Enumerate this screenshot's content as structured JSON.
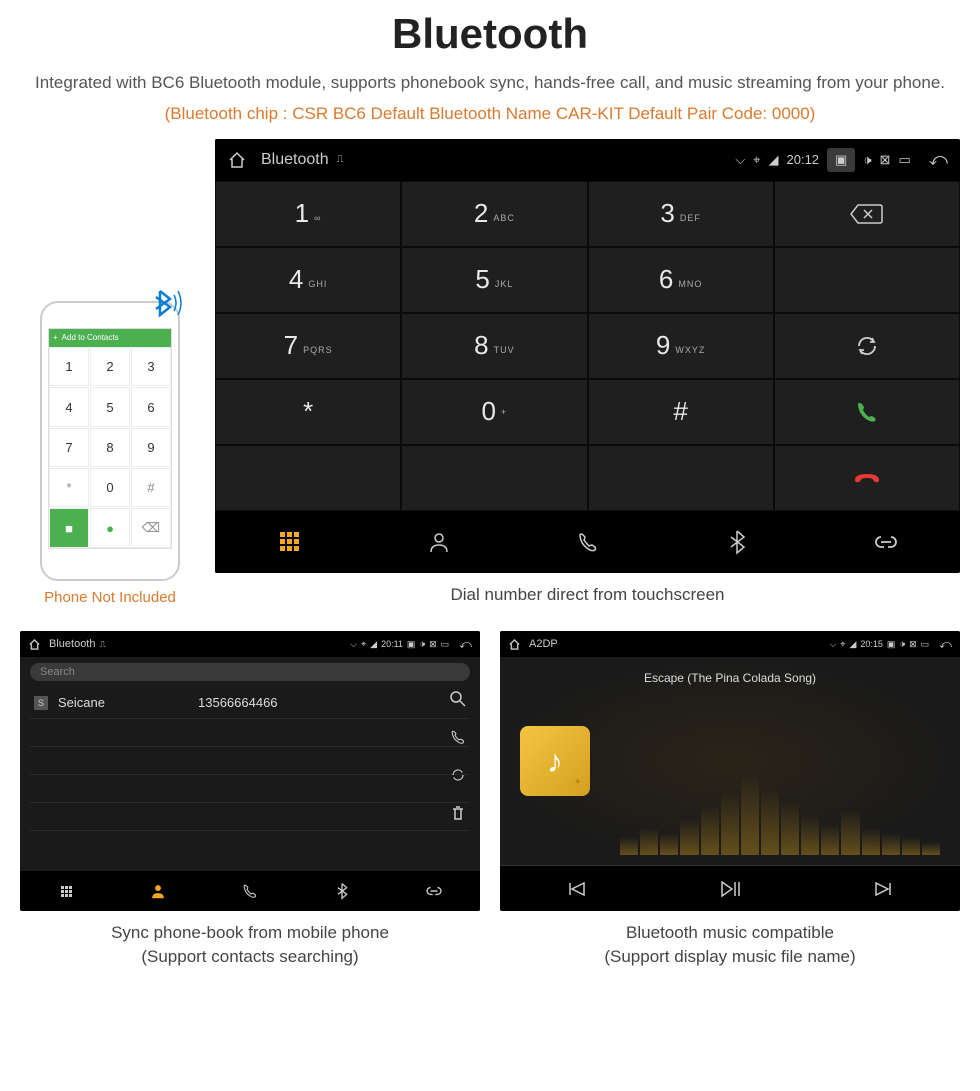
{
  "header": {
    "title": "Bluetooth",
    "subtitle": "Integrated with BC6 Bluetooth module, supports phonebook sync, hands-free call, and music streaming from your phone.",
    "specs": "(Bluetooth chip : CSR BC6    Default Bluetooth Name CAR-KIT    Default Pair Code: 0000)"
  },
  "phone": {
    "add_contacts": "Add to Contacts",
    "caption": "Phone Not Included"
  },
  "dialer": {
    "status_label": "Bluetooth",
    "time": "20:12",
    "keys": [
      {
        "d": "1",
        "s": "∞"
      },
      {
        "d": "2",
        "s": "ABC"
      },
      {
        "d": "3",
        "s": "DEF"
      },
      {
        "d": "4",
        "s": "GHI"
      },
      {
        "d": "5",
        "s": "JKL"
      },
      {
        "d": "6",
        "s": "MNO"
      },
      {
        "d": "7",
        "s": "PQRS"
      },
      {
        "d": "8",
        "s": "TUV"
      },
      {
        "d": "9",
        "s": "WXYZ"
      },
      {
        "d": "*",
        "s": ""
      },
      {
        "d": "0",
        "s": "+"
      },
      {
        "d": "#",
        "s": ""
      }
    ],
    "caption": "Dial number direct from touchscreen"
  },
  "phonebook": {
    "status_label": "Bluetooth",
    "time": "20:11",
    "search_placeholder": "Search",
    "contact_badge": "S",
    "contact_name": "Seicane",
    "contact_number": "13566664466",
    "caption_l1": "Sync phone-book from mobile phone",
    "caption_l2": "(Support contacts searching)"
  },
  "music": {
    "status_label": "A2DP",
    "time": "20:15",
    "song": "Escape (The Pina Colada Song)",
    "caption_l1": "Bluetooth music compatible",
    "caption_l2": "(Support display music file name)"
  }
}
